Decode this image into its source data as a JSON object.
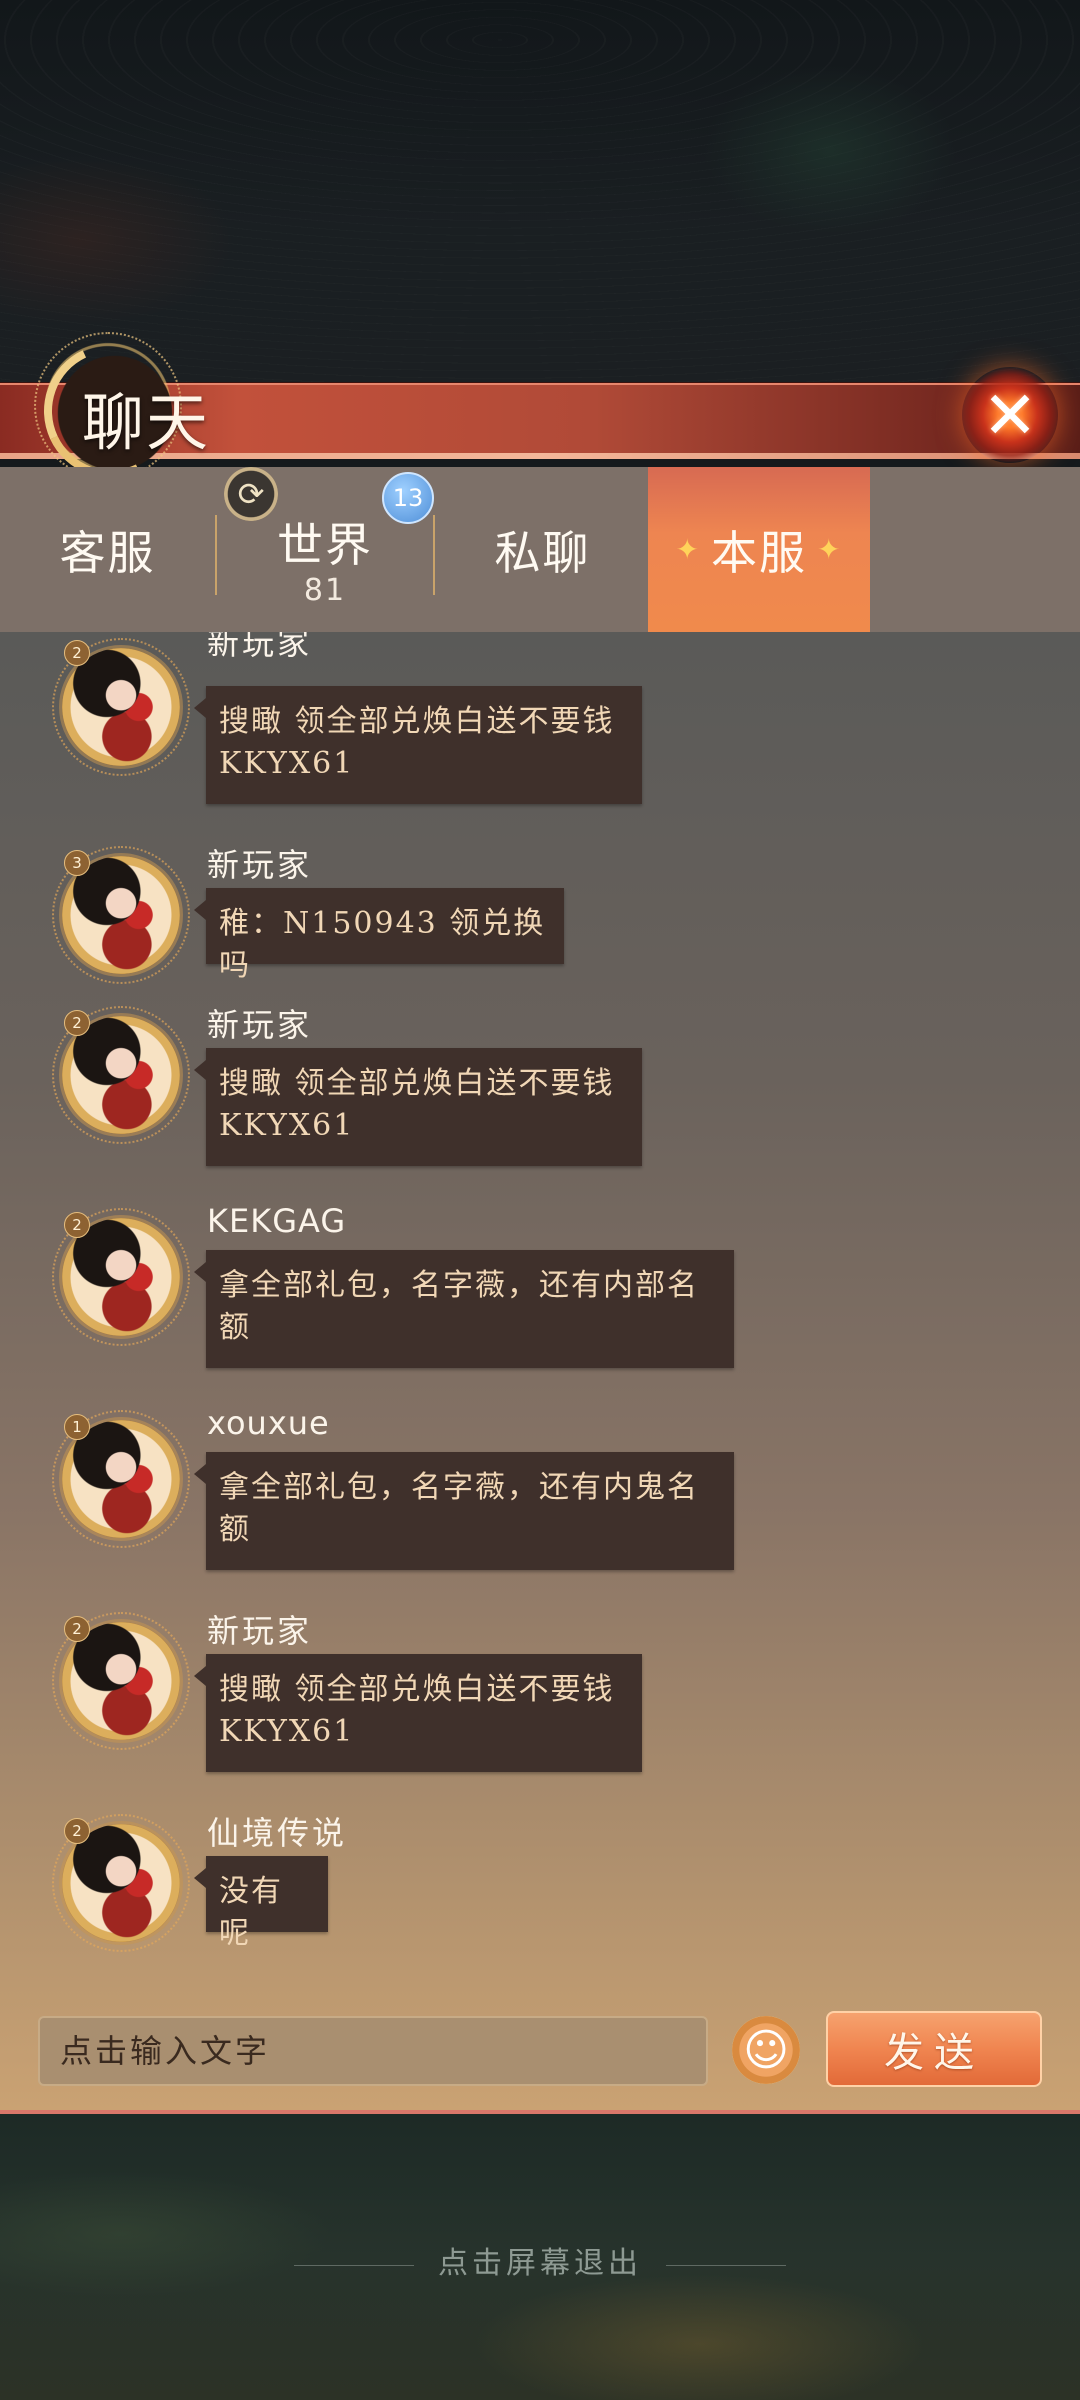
{
  "header": {
    "title": "聊天",
    "close_icon": "close-icon"
  },
  "tabs": [
    {
      "label": "客服"
    },
    {
      "label": "世界",
      "count": "81",
      "badge": "13"
    },
    {
      "label": "私聊"
    },
    {
      "label": "本服",
      "active": true
    }
  ],
  "messages": [
    {
      "sender": "新玩家",
      "level": "2",
      "text_line1": "搜瞰 领全部兑焕白送不要钱",
      "text_line2": "KKYX61"
    },
    {
      "sender": "新玩家",
      "level": "3",
      "text_line1": "稚：N150943 领兑换吗",
      "text_line2": ""
    },
    {
      "sender": "新玩家",
      "level": "2",
      "text_line1": "搜瞰 领全部兑焕白送不要钱",
      "text_line2": "KKYX61"
    },
    {
      "sender": "KEKGAG",
      "level": "2",
      "text_line1": "拿全部礼包，名字薇，还有内部名",
      "text_line2": "额"
    },
    {
      "sender": "xouxue",
      "level": "1",
      "text_line1": "拿全部礼包，名字薇，还有内鬼名",
      "text_line2": "额"
    },
    {
      "sender": "新玩家",
      "level": "2",
      "text_line1": "搜瞰 领全部兑焕白送不要钱",
      "text_line2": "KKYX61"
    },
    {
      "sender": "仙境传说",
      "level": "2",
      "text_line1": "没有呢",
      "text_line2": ""
    }
  ],
  "input": {
    "placeholder": "点击输入文字",
    "send_label": "发送",
    "emoji_icon": "emoji-icon"
  },
  "footer": {
    "exit_hint": "点击屏幕退出"
  },
  "colors": {
    "accent": "#f08a4c",
    "header_red": "#c2513b",
    "bubble": "#3f302b",
    "bubble_text": "#f1d7b6"
  }
}
